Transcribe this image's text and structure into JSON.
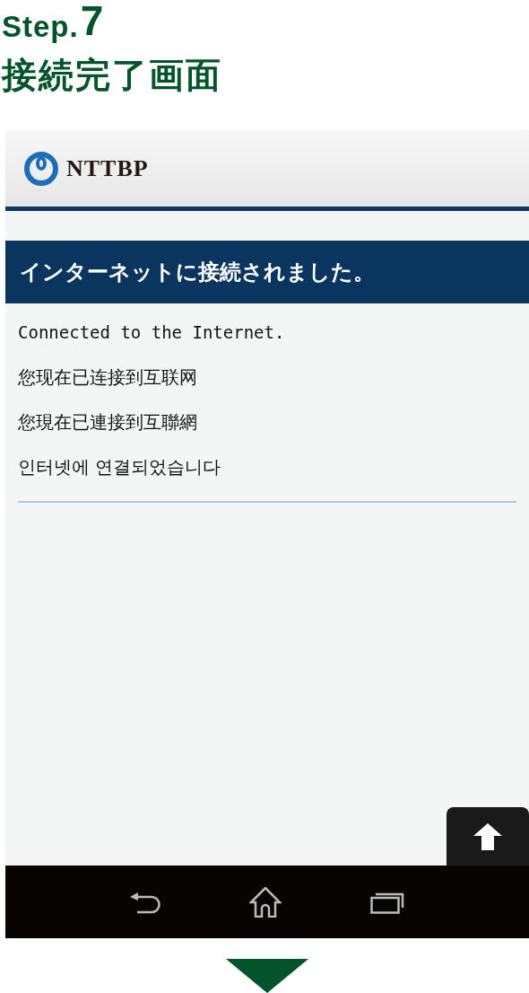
{
  "step": {
    "label": "Step.",
    "number": "7"
  },
  "heading": "接続完了画面",
  "screen": {
    "logo_text": "NTTBP",
    "banner": "インターネットに接続されました。",
    "messages": [
      {
        "text": "Connected to the Internet.",
        "kind": "latin"
      },
      {
        "text": "您现在已连接到互联网",
        "kind": "cjk"
      },
      {
        "text": "您現在已連接到互聯網",
        "kind": "cjk"
      },
      {
        "text": "인터넷에 연결되었습니다",
        "kind": "cjk"
      }
    ]
  }
}
